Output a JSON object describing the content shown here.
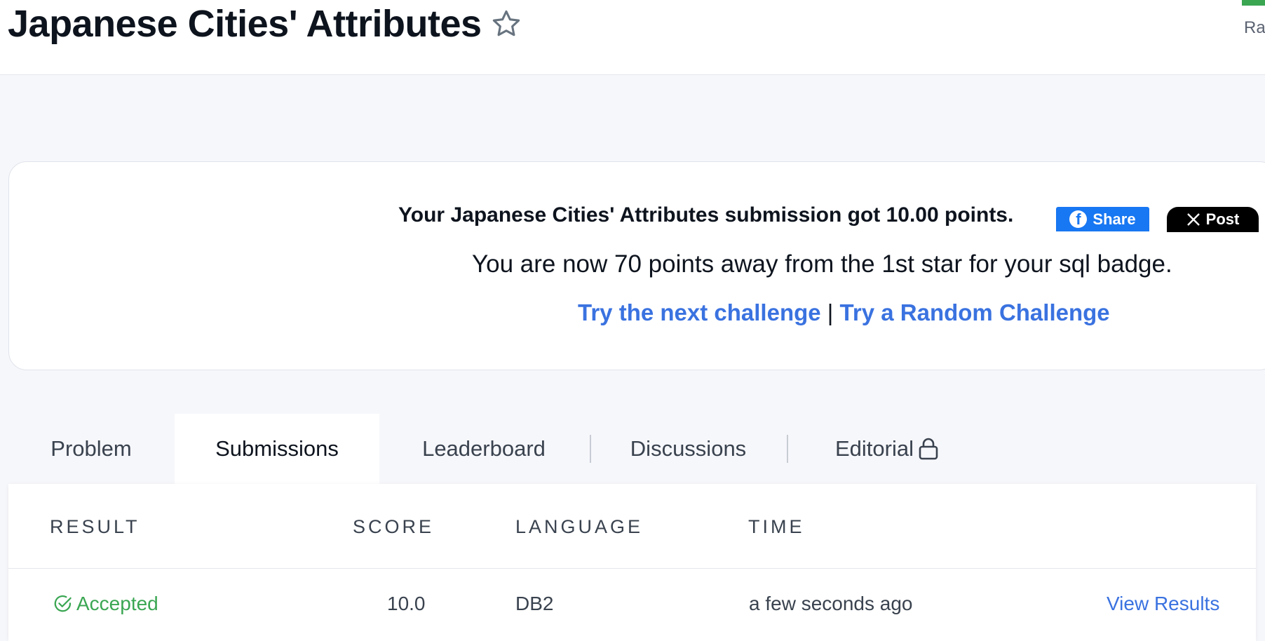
{
  "header": {
    "title": "Japanese Cities' Attributes",
    "right_partial_text": "Ra"
  },
  "banner": {
    "message": "Your Japanese Cities' Attributes submission got 10.00 points.",
    "share_label": "Share",
    "post_label": "Post",
    "progress_text": "You are now 70 points away from the 1st star for your sql badge.",
    "next_challenge_link": "Try the next challenge",
    "separator": "|",
    "random_challenge_link": "Try a Random Challenge"
  },
  "tabs": {
    "problem": "Problem",
    "submissions": "Submissions",
    "leaderboard": "Leaderboard",
    "discussions": "Discussions",
    "editorial": "Editorial"
  },
  "table": {
    "headers": [
      "RESULT",
      "SCORE",
      "LANGUAGE",
      "TIME"
    ],
    "rows": [
      {
        "result": "Accepted",
        "score": "10.0",
        "language": "DB2",
        "time": "a few seconds ago",
        "action": "View Results"
      }
    ]
  },
  "colors": {
    "accent_blue": "#3a72e0",
    "success_green": "#3aa652",
    "facebook_blue": "#1877f2",
    "x_black": "#000000"
  },
  "icons": [
    "star-outline-icon",
    "facebook-icon",
    "x-logo-icon",
    "lock-icon",
    "check-circle-icon"
  ]
}
